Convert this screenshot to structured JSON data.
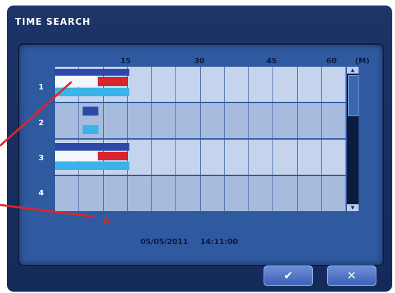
{
  "dialog": {
    "title": "TIME SEARCH",
    "minute_labels": [
      "15",
      "30",
      "45",
      "60"
    ],
    "unit_label": "(M)",
    "row_labels": [
      "1",
      "2",
      "3",
      "4"
    ],
    "marker": "A",
    "date": "05/05/2011",
    "time": "14:11:00"
  },
  "buttons": {
    "ok_icon": "check-icon",
    "ok_glyph": "✔",
    "cancel_icon": "close-icon",
    "cancel_glyph": "✕"
  },
  "colors": {
    "recording_navy": "#2d48a8",
    "recording_red": "#d8242b",
    "recording_cyan": "#38b4e8",
    "callout_line": "#e0242a"
  }
}
